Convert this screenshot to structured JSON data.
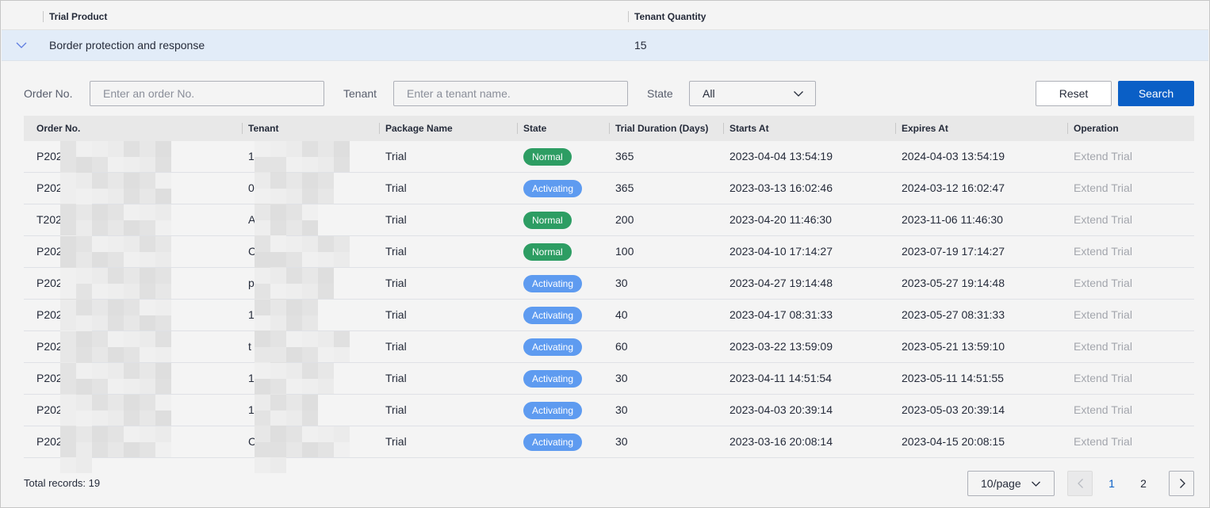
{
  "outer_table": {
    "headers": [
      "Trial Product",
      "Tenant Quantity"
    ],
    "row": {
      "product": "Border protection and response",
      "tenant_quantity": "15"
    }
  },
  "filters": {
    "order_label": "Order No.",
    "order_placeholder": "Enter an order No.",
    "tenant_label": "Tenant",
    "tenant_placeholder": "Enter a tenant name.",
    "state_label": "State",
    "state_value": "All",
    "reset_label": "Reset",
    "search_label": "Search"
  },
  "inner_table": {
    "headers": [
      "Order No.",
      "Tenant",
      "Package Name",
      "State",
      "Trial Duration (Days)",
      "Starts At",
      "Expires At",
      "Operation"
    ],
    "rows": [
      {
        "order": "P202",
        "tenant": "1",
        "package": "Trial",
        "state": "Normal",
        "duration": "365",
        "starts": "2023-04-04 13:54:19",
        "expires": "2024-04-03 13:54:19",
        "operation": "Extend Trial"
      },
      {
        "order": "P202",
        "tenant": "0",
        "package": "Trial",
        "state": "Activating",
        "duration": "365",
        "starts": "2023-03-13 16:02:46",
        "expires": "2024-03-12 16:02:47",
        "operation": "Extend Trial"
      },
      {
        "order": "T202",
        "tenant": "A",
        "package": "Trial",
        "state": "Normal",
        "duration": "200",
        "starts": "2023-04-20 11:46:30",
        "expires": "2023-11-06 11:46:30",
        "operation": "Extend Trial"
      },
      {
        "order": "P202",
        "tenant": "C",
        "package": "Trial",
        "state": "Normal",
        "duration": "100",
        "starts": "2023-04-10 17:14:27",
        "expires": "2023-07-19 17:14:27",
        "operation": "Extend Trial"
      },
      {
        "order": "P202",
        "tenant": "p",
        "package": "Trial",
        "state": "Activating",
        "duration": "30",
        "starts": "2023-04-27 19:14:48",
        "expires": "2023-05-27 19:14:48",
        "operation": "Extend Trial"
      },
      {
        "order": "P202",
        "tenant": "1",
        "package": "Trial",
        "state": "Activating",
        "duration": "40",
        "starts": "2023-04-17 08:31:33",
        "expires": "2023-05-27 08:31:33",
        "operation": "Extend Trial"
      },
      {
        "order": "P202",
        "tenant": "t",
        "package": "Trial",
        "state": "Activating",
        "duration": "60",
        "starts": "2023-03-22 13:59:09",
        "expires": "2023-05-21 13:59:10",
        "operation": "Extend Trial"
      },
      {
        "order": "P202",
        "tenant": "1",
        "package": "Trial",
        "state": "Activating",
        "duration": "30",
        "starts": "2023-04-11 14:51:54",
        "expires": "2023-05-11 14:51:55",
        "operation": "Extend Trial"
      },
      {
        "order": "P202",
        "tenant": "1",
        "package": "Trial",
        "state": "Activating",
        "duration": "30",
        "starts": "2023-04-03 20:39:14",
        "expires": "2023-05-03 20:39:14",
        "operation": "Extend Trial"
      },
      {
        "order": "P202",
        "tenant": "C",
        "package": "Trial",
        "state": "Activating",
        "duration": "30",
        "starts": "2023-03-16 20:08:14",
        "expires": "2023-04-15 20:08:15",
        "operation": "Extend Trial"
      }
    ]
  },
  "footer": {
    "total_records": "Total records: 19",
    "page_size": "10/page",
    "pages": [
      "1",
      "2"
    ],
    "current_page": "1"
  },
  "colors": {
    "primary": "#0a5fc6",
    "state_normal": "#2d9d63",
    "state_activating": "#5e9bf0",
    "expanded_row": "#e2ecf8",
    "link_disabled": "#a3a6ad"
  },
  "icons": {
    "expand": "chevron-down-icon",
    "select": "chevron-down-icon",
    "prev_page": "chevron-left-icon",
    "next_page": "chevron-right-icon"
  }
}
